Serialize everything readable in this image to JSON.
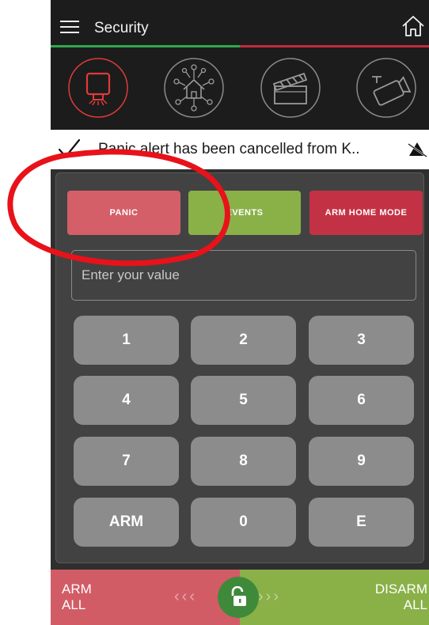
{
  "header": {
    "title": "Security",
    "menu_icon": "hamburger-menu-icon",
    "home_icon": "home-icon",
    "tab_progress": 0.5
  },
  "devices": [
    {
      "icon": "siren-icon",
      "selected": true
    },
    {
      "icon": "network-home-icon",
      "selected": false
    },
    {
      "icon": "clapperboard-icon",
      "selected": false
    },
    {
      "icon": "camera-icon",
      "selected": false
    }
  ],
  "notification": {
    "icon": "check-icon",
    "text": "Panic alert has been cancelled from K..",
    "trailing_icon": "bell-off-icon"
  },
  "actions": {
    "panic_label": "PANIC",
    "events_label": "EVENTS",
    "arm_home_label": "ARM HOME MODE"
  },
  "input": {
    "placeholder": "Enter your value",
    "value": ""
  },
  "keypad": {
    "k1": "1",
    "k2": "2",
    "k3": "3",
    "k4": "4",
    "k5": "5",
    "k6": "6",
    "k7": "7",
    "k8": "8",
    "k9": "9",
    "arm": "ARM",
    "k0": "0",
    "enter": "E"
  },
  "slider": {
    "arm_label": "ARM\nALL",
    "disarm_label": "DISARM\nALL",
    "left_chevrons": "‹‹‹",
    "right_chevrons": "›››",
    "knob_icon": "unlock-icon"
  },
  "colors": {
    "header_bg": "#1c1c1c",
    "selected_device": "#e03a3a",
    "panic": "#d45f68",
    "events": "#8ab048",
    "arm_home": "#c33244",
    "arm_all": "#d25c66",
    "disarm_all": "#8ab048",
    "annotation": "#e8121a"
  }
}
